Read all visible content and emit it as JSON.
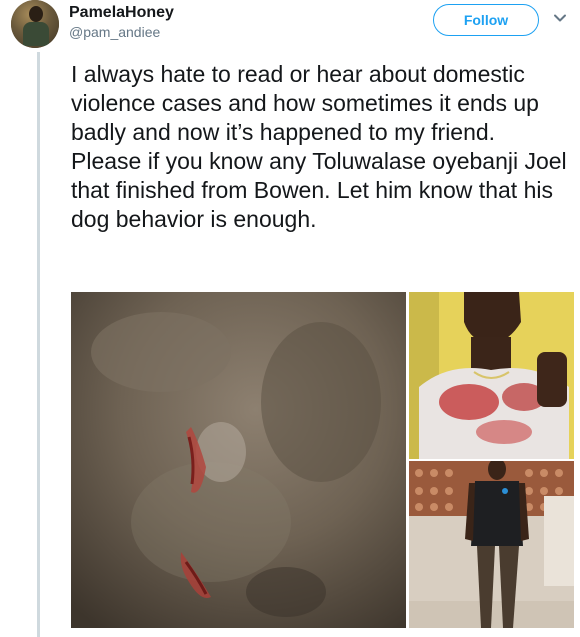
{
  "user": {
    "display_name": "PamelaHoney",
    "handle": "@pam_andiee"
  },
  "actions": {
    "follow_label": "Follow"
  },
  "tweet": {
    "text": "I always hate to read or hear about domestic violence cases and how sometimes it ends up badly and now it’s happened to my friend. Please if you know any Toluwalase oyebanji Joel that finished from Bowen. Let him know that his dog behavior is enough."
  },
  "media": {
    "count": 3,
    "items": [
      "wound-photo",
      "person-neck-photo",
      "person-standing-photo"
    ]
  },
  "icons": {
    "chevron": "chevron-down-icon"
  },
  "colors": {
    "accent": "#1da1f2",
    "secondary_text": "#657786",
    "thread_line": "#cfd9de"
  }
}
